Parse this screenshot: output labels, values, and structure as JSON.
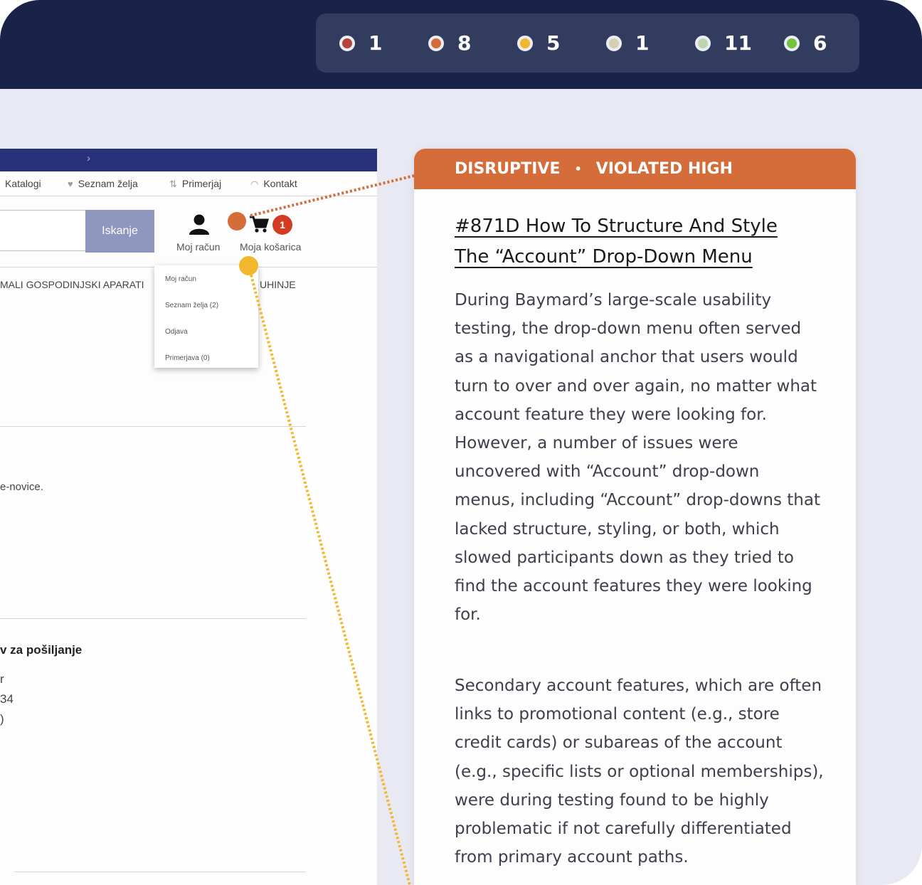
{
  "stats": [
    {
      "count": "1",
      "color": "#b4433f"
    },
    {
      "count": "8",
      "color": "#d46d3a"
    },
    {
      "count": "5",
      "color": "#f1b82d"
    },
    {
      "count": "1",
      "color": "#d5cfb2"
    },
    {
      "count": "11",
      "color": "#bcd6b3"
    },
    {
      "count": "6",
      "color": "#75c23f"
    }
  ],
  "site": {
    "nav": [
      "Katalogi",
      "Seznam želja",
      "Primerjaj",
      "Kontakt"
    ],
    "search_button": "Iskanje",
    "account_label": "Moj račun",
    "cart_label": "Moja košarica",
    "cart_count": "1",
    "dropdown": [
      "Moj račun",
      "Seznam želja (2)",
      "Odjava",
      "Primerjava (0)"
    ],
    "categories": [
      "MALI GOSPODINJSKI APARATI",
      "UHINJE"
    ],
    "newsletter_fragment": "e-novice.",
    "shipping_heading": "v za pošiljanje",
    "address_lines": [
      "r",
      "34",
      ")"
    ]
  },
  "markers": {
    "orange": "#d46d3a",
    "yellow": "#f1b82d"
  },
  "card": {
    "severity": "DISRUPTIVE",
    "status": "VIOLATED HIGH",
    "separator": "•",
    "header_color": "#d46d3a",
    "title": "#871D How To Structure And Style The “Account” Drop-Down Menu",
    "paragraphs": [
      "During Baymard’s large-scale usability testing, the drop-down menu often served as a navigational anchor that users would turn to over and over again, no matter what account feature they were looking for. However, a number of issues were uncovered with “Account” drop-down menus, including “Account” drop-downs that lacked structure, styling, or both, which slowed participants down as they tried to find the account features they were looking for.",
      "Secondary account features, which are often links to promotional content (e.g., store credit cards) or subareas of the account (e.g., specific lists or optional memberships), were during testing found to be highly problematic if not carefully differentiated from primary account paths."
    ]
  }
}
